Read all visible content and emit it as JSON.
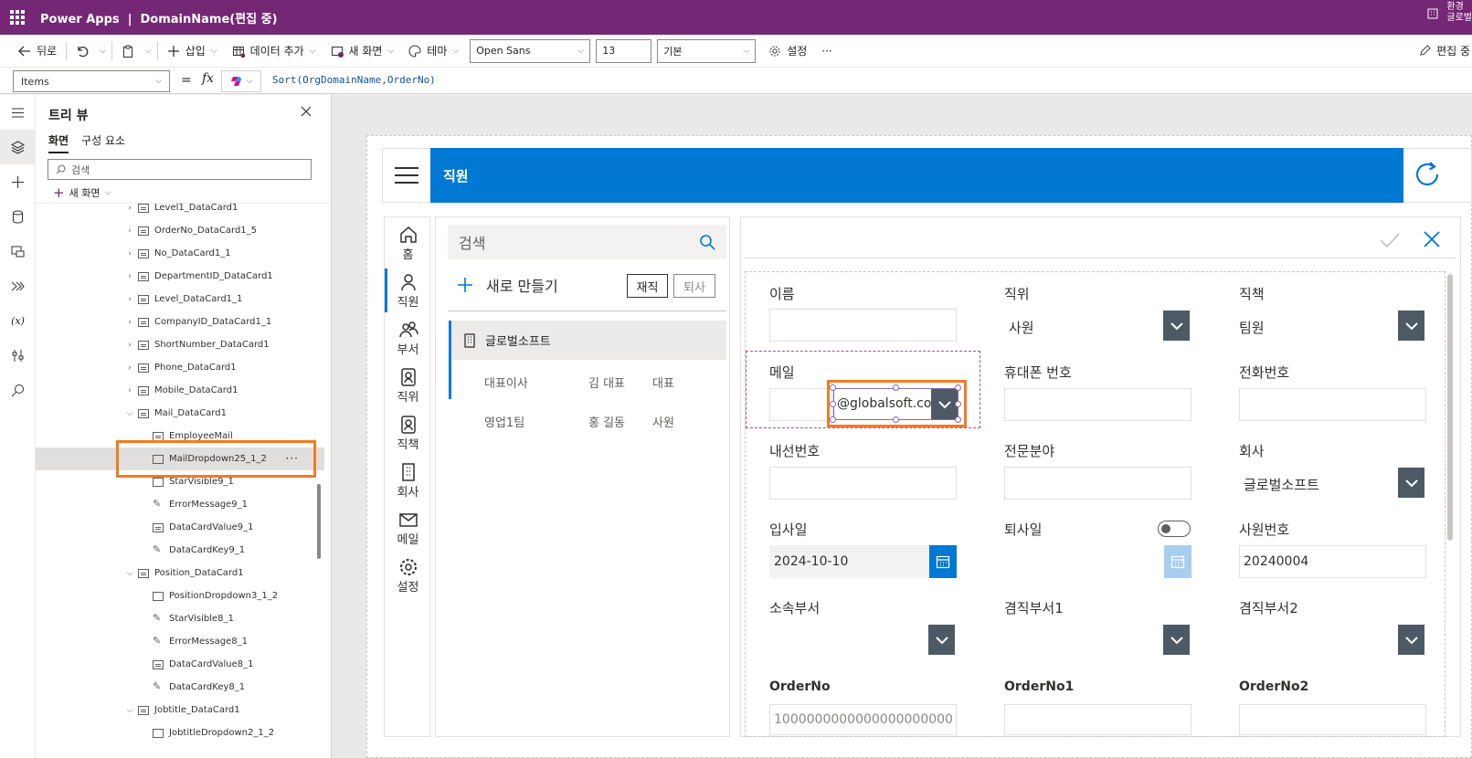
{
  "titlebar": {
    "app_name": "Power Apps",
    "separator": "|",
    "doc_title": "DomainName(편집 중)",
    "env_label": "환경",
    "env_name": "글로벌"
  },
  "cmdbar": {
    "back": "뒤로",
    "insert": "삽입",
    "add_data": "데이터 추가",
    "new_screen": "새 화면",
    "theme": "테마",
    "font": "Open Sans",
    "font_size": "13",
    "weight": "기본",
    "settings": "설정",
    "more": "···",
    "edit_mode": "편집 중"
  },
  "formula": {
    "property": "Items",
    "equals": "=",
    "fx": "fx",
    "expression": "Sort(OrgDomainName,OrderNo)"
  },
  "tree": {
    "title": "트리 뷰",
    "tabs": [
      "화면",
      "구성 요소"
    ],
    "search_placeholder": "검색",
    "new_screen": "새 화면",
    "nodes": [
      {
        "label": "Level1_DataCard1"
      },
      {
        "label": "OrderNo_DataCard1_5"
      },
      {
        "label": "No_DataCard1_1"
      },
      {
        "label": "DepartmentID_DataCard1"
      },
      {
        "label": "Level_DataCard1_1"
      },
      {
        "label": "CompanyID_DataCard1_1"
      },
      {
        "label": "ShortNumber_DataCard1"
      },
      {
        "label": "Phone_DataCard1"
      },
      {
        "label": "Mobile_DataCard1"
      },
      {
        "label": "Mail_DataCard1"
      },
      {
        "label": "EmployeeMail"
      },
      {
        "label": "MailDropdown25_1_2"
      },
      {
        "label": "StarVisible9_1"
      },
      {
        "label": "ErrorMessage9_1"
      },
      {
        "label": "DataCardValue9_1"
      },
      {
        "label": "DataCardKey9_1"
      },
      {
        "label": "Position_DataCard1"
      },
      {
        "label": "PositionDropdown3_1_2"
      },
      {
        "label": "StarVisible8_1"
      },
      {
        "label": "ErrorMessage8_1"
      },
      {
        "label": "DataCardValue8_1"
      },
      {
        "label": "DataCardKey8_1"
      },
      {
        "label": "Jobtitle_DataCard1"
      },
      {
        "label": "JobtitleDropdown2_1_2"
      }
    ]
  },
  "app": {
    "header_title": "직원",
    "nav": [
      "홈",
      "직원",
      "부서",
      "직위",
      "직책",
      "회사",
      "메일",
      "설정"
    ],
    "search_placeholder": "검색",
    "new_button": "새로 만들기",
    "toggle_active": "재직",
    "toggle_retired": "퇴사",
    "group_name": "글로벌소프트",
    "rows": [
      {
        "dept": "대표이사",
        "name": "김 대표",
        "role": "대표"
      },
      {
        "dept": "영업1팀",
        "name": "홍 길동",
        "role": "사원"
      }
    ]
  },
  "form": {
    "name_label": "이름",
    "position_label": "직위",
    "position_value": "사원",
    "jobtitle_label": "직책",
    "jobtitle_value": "팀원",
    "mail_label": "메일",
    "mail_domain": "@globalsoft.co",
    "mobile_label": "휴대폰 번호",
    "phone_label": "전화번호",
    "ext_label": "내선번호",
    "specialty_label": "전문분야",
    "company_label": "회사",
    "company_value": "글로벌소프트",
    "hire_label": "입사일",
    "hire_value": "2024-10-10",
    "retire_label": "퇴사일",
    "empno_label": "사원번호",
    "empno_value": "20240004",
    "dept_label": "소속부서",
    "dept2_label": "겸직부서1",
    "dept3_label": "겸직부서2",
    "orderno_label": "OrderNo",
    "orderno_value": "1000000000000000000000",
    "orderno1_label": "OrderNo1",
    "orderno2_label": "OrderNo2"
  }
}
